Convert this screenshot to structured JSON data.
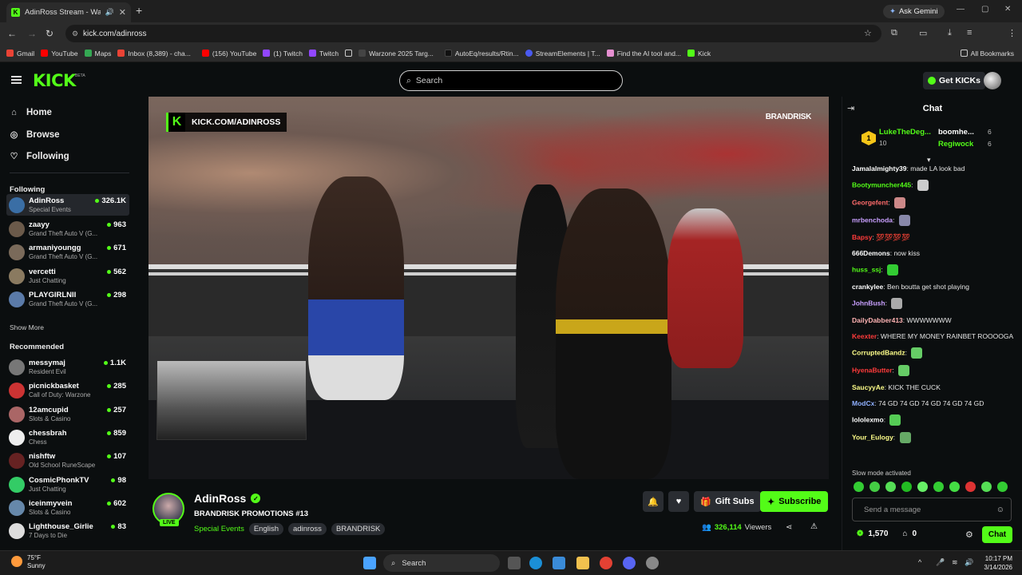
{
  "browser": {
    "tab_title": "AdinRoss Stream - Watch L",
    "ask_gemini": "Ask Gemini",
    "url": "kick.com/adinross",
    "bookmarks": [
      "Gmail",
      "YouTube",
      "Maps",
      "Inbox (8,389) - cha...",
      "(156) YouTube",
      "(1) Twitch",
      "Twitch",
      "Warzone 2025 Targ...",
      "AutoEq/results/Rtin...",
      "StreamElements | T...",
      "Find the AI tool and...",
      "Kick"
    ],
    "all_bookmarks": "All Bookmarks"
  },
  "topbar": {
    "logo": "KICK",
    "beta": "BETA",
    "search_placeholder": "Search",
    "get_kicks": "Get KICKs"
  },
  "sidebar": {
    "nav": [
      {
        "label": "Home",
        "icon": "home-icon"
      },
      {
        "label": "Browse",
        "icon": "compass-icon"
      },
      {
        "label": "Following",
        "icon": "heart-icon"
      }
    ],
    "following_title": "Following",
    "following": [
      {
        "name": "AdinRoss",
        "game": "Special Events",
        "viewers": "326.1K",
        "color": "#3a6ea5"
      },
      {
        "name": "zaayy",
        "game": "Grand Theft Auto V (G...",
        "viewers": "963",
        "color": "#6b5a4a"
      },
      {
        "name": "armaniyoungg",
        "game": "Grand Theft Auto V (G...",
        "viewers": "671",
        "color": "#7a6a5a"
      },
      {
        "name": "vercetti",
        "game": "Just Chatting",
        "viewers": "562",
        "color": "#8a7a60"
      },
      {
        "name": "PLAYGIRLNII",
        "game": "Grand Theft Auto V (G...",
        "viewers": "298",
        "color": "#5a7aa8"
      }
    ],
    "show_more": "Show More",
    "recommended_title": "Recommended",
    "recommended": [
      {
        "name": "messymaj",
        "game": "Resident Evil",
        "viewers": "1.1K",
        "color": "#777"
      },
      {
        "name": "picnickbasket",
        "game": "Call of Duty: Warzone",
        "viewers": "285",
        "color": "#c33"
      },
      {
        "name": "12amcupid",
        "game": "Slots & Casino",
        "viewers": "257",
        "color": "#a66"
      },
      {
        "name": "chessbrah",
        "game": "Chess",
        "viewers": "859",
        "color": "#eee"
      },
      {
        "name": "nishftw",
        "game": "Old School RuneScape",
        "viewers": "107",
        "color": "#622"
      },
      {
        "name": "CosmicPhonkTV",
        "game": "Just Chatting",
        "viewers": "98",
        "color": "#3c6"
      },
      {
        "name": "iceinmyvein",
        "game": "Slots & Casino",
        "viewers": "602",
        "color": "#68a"
      },
      {
        "name": "Lighthouse_Girlie",
        "game": "7 Days to Die",
        "viewers": "83",
        "color": "#ddd"
      }
    ]
  },
  "video": {
    "watermark": "KICK.COM/ADINROSS",
    "sponsor": "BRANDRISK"
  },
  "stream": {
    "name": "AdinRoss",
    "live": "LIVE",
    "title": "BRANDRISK PROMOTIONS #13",
    "category": "Special Events",
    "tags": [
      "English",
      "adinross",
      "BRANDRISK"
    ],
    "gift_label": "Gift Subs",
    "subscribe_label": "Subscribe",
    "viewers": "326,114",
    "viewers_label": "Viewers"
  },
  "chat": {
    "title": "Chat",
    "pinned": {
      "rank": "1",
      "top_name": "LukeTheDeg...",
      "top_value": "10",
      "second_name": "boomhe...",
      "second_value": "6",
      "third_name": "Regiwock",
      "third_value": "6"
    },
    "messages": [
      {
        "user": "Jamalalmighty39",
        "color": "#ffffff",
        "text": "made LA look bad"
      },
      {
        "user": "Bootymuncher445",
        "color": "#53fc18",
        "text": ""
      },
      {
        "user": "Georgefent",
        "color": "#ff6b6b",
        "text": ""
      },
      {
        "user": "mrbenchoda",
        "color": "#c9a0ff",
        "text": ""
      },
      {
        "user": "Bapsy",
        "color": "#ff3b3b",
        "text": "💯💯💯💯"
      },
      {
        "user": "666Demons",
        "color": "#ffffff",
        "text": "now kiss"
      },
      {
        "user": "huss_ssj",
        "color": "#53fc18",
        "text": ""
      },
      {
        "user": "crankylee",
        "color": "#ffffff",
        "text": "Ben boutta get shot playing"
      },
      {
        "user": "JohnBush",
        "color": "#c9a0ff",
        "text": ""
      },
      {
        "user": "DailyDabber413",
        "color": "#ffb3b3",
        "text": "WWWWWWW"
      },
      {
        "user": "Keexter",
        "color": "#ff3b3b",
        "text": "WHERE MY MONEY RAINBET ROOOOGA"
      },
      {
        "user": "CorruptedBandz",
        "color": "#ffff8a",
        "text": ""
      },
      {
        "user": "HyenaButter",
        "color": "#ff3b3b",
        "text": ""
      },
      {
        "user": "SaucyyAe",
        "color": "#ffff8a",
        "text": "KICK THE CUCK"
      },
      {
        "user": "ModCx",
        "color": "#8fb0ff",
        "text": "74 GD 74 GD 74 GD 74 GD 74 GD"
      },
      {
        "user": "lololexmo",
        "color": "#ffffff",
        "text": ""
      },
      {
        "user": "Your_Eulogy",
        "color": "#ffff8a",
        "text": ""
      }
    ],
    "slow_mode": "Slow mode activated",
    "send_placeholder": "Send a message",
    "points": "1,570",
    "claims": "0",
    "chat_button": "Chat"
  },
  "taskbar": {
    "temp": "75°F",
    "condition": "Sunny",
    "search": "Search",
    "time": "10:17 PM",
    "date": "3/14/2026"
  }
}
